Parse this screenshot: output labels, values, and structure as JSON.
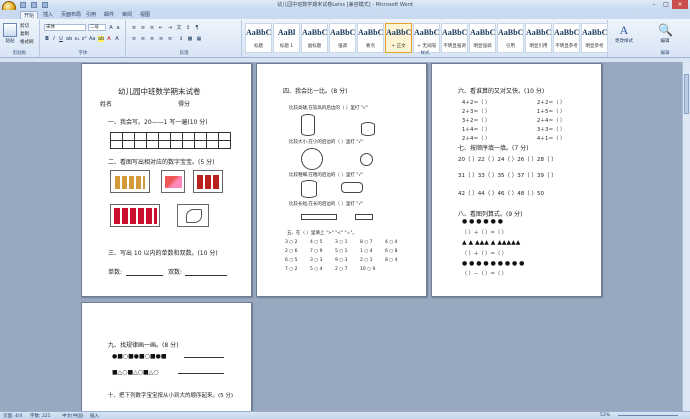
{
  "window": {
    "title": "幼儿园中班数学期末试卷Lelvs [兼容模式] - Microsoft Word"
  },
  "tabs": [
    "开始",
    "插入",
    "页面布局",
    "引用",
    "邮件",
    "审阅",
    "视图"
  ],
  "ribbon": {
    "font_name": "宋体",
    "font_size": "二号",
    "groups": [
      "剪贴板",
      "字体",
      "段落",
      "样式",
      "编辑"
    ],
    "paste_label": "粘贴",
    "cut": "剪切",
    "copy": "复制",
    "format_painter": "格式刷",
    "styles": [
      {
        "sample": "AaBbC",
        "name": "标题"
      },
      {
        "sample": "AaBl",
        "name": "标题 1"
      },
      {
        "sample": "AaBbC",
        "name": "副标题"
      },
      {
        "sample": "AaBbCcD",
        "name": "强调"
      },
      {
        "sample": "AaBbCcD",
        "name": "要点"
      },
      {
        "sample": "AaBbCcD",
        "name": "+ 正文"
      },
      {
        "sample": "AaBbCcDc",
        "name": "+ 无间隔"
      },
      {
        "sample": "AaBbCcDc",
        "name": "不明显强调"
      },
      {
        "sample": "AaBbCcDc",
        "name": "明显强调"
      },
      {
        "sample": "AaBbCcDc",
        "name": "引用"
      },
      {
        "sample": "AaBbCcDc",
        "name": "明显引用"
      },
      {
        "sample": "AaBbCcD",
        "name": "不明显参考"
      },
      {
        "sample": "AaBbCcI",
        "name": "明显参考"
      }
    ],
    "change_styles": "更改样式",
    "edit": "编辑"
  },
  "page1": {
    "title": "幼儿园中班数学期末试卷",
    "name_label": "姓名",
    "score_label": "得分",
    "q1": "一、我会写。20——1 写一遍(10 分)",
    "q2": "二、看图写出相对应的数字宝宝。(5 分)",
    "q3": "三、写出 10 以内的单数和双数。(10 分)",
    "odd": "单数:",
    "even": "双数:"
  },
  "page2": {
    "q4": "四、我会比一比。(8 分)",
    "items": [
      "比较高矮,在较高的后边的（ ）里打 \"√\"",
      "比较大小,在小的后边的（ ）里打 \"√\"",
      "比较粗细,在粗的后边的（ ）里打 \"√\"",
      "比较长短,在长的后边的（ ）里打 \"√\""
    ],
    "q5": "五、在（ ）里填上 \">\" \"<\" \"=\"。",
    "compare": [
      "3 ○ 2",
      "4 ○ 5",
      "3 ○ 1",
      "8 ○ 7",
      "4 ○ 4",
      "2 ○ 6",
      "7 ○ 9",
      "5 ○ 1",
      "1 ○ 4",
      "6 ○ 8",
      "6 ○ 5",
      "3 ○ 3",
      "9 ○ 3",
      "2 ○ 1",
      "8 ○ 4",
      "7 ○ 2",
      "5 ○ 4",
      "2 ○ 7",
      "10 ○ 9"
    ]
  },
  "page3": {
    "q6": "六、看谁算的又对又快。(10 分)",
    "sums": [
      [
        "4＋2＝（    ）",
        "2＋2＝（    ）"
      ],
      [
        "2＋3＝（    ）",
        "1＋5＝（    ）"
      ],
      [
        "3＋2＝（    ）",
        "2＋4＝（    ）"
      ],
      [
        "1＋4＝（    ）",
        "3＋3＝（    ）"
      ],
      [
        "2＋4＝（    ）",
        "4＋1＝（    ）"
      ]
    ],
    "q7": "七、按顺序填一填。(7 分)",
    "seq": [
      "20（    ）22（    ）24（    ）26（    ）28（    ）",
      "31（    ）33（    ）35（    ）37（    ）39（    ）",
      "42（    ）44（    ）46（    ）48（    ）50"
    ],
    "q8": "八、看图列算式。(9 分)",
    "eq": [
      "（    ）＋（    ）＝（    ）",
      "（    ）＋（    ）＝（    ）",
      "（    ）－（    ）＝（    ）"
    ]
  },
  "page4": {
    "q9": "九、找规律画一画。(8 分)",
    "q10": "十、把下列数字宝宝按从小到大的顺序起来。(5 分)"
  },
  "status": {
    "page": "页面: 4/4",
    "words": "字数: 221",
    "lang": "中文(中国)",
    "mode": "插入",
    "zoom": "53%"
  }
}
